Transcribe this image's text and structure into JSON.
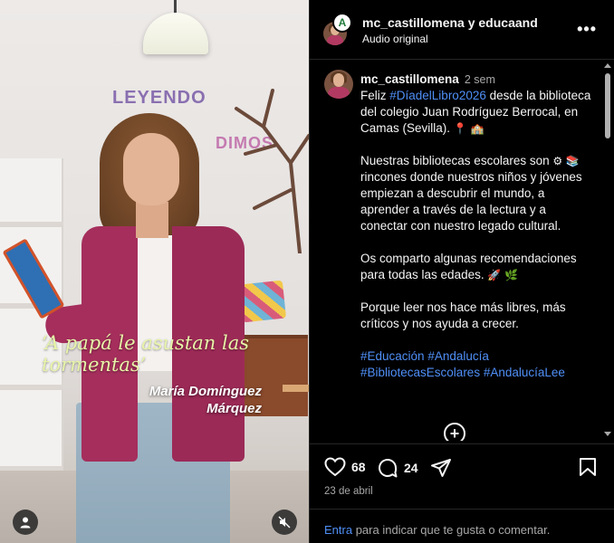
{
  "video": {
    "quote": "‘A papá le asustan las tormentas’",
    "author_first": "María Domínguez",
    "author_last": "Márquez",
    "wall_sign_1": "LEYENDO",
    "wall_sign_2": "DIMOS"
  },
  "header": {
    "title": "mc_castillomena y educaand",
    "subtitle": "Audio original",
    "logo_letter": "A",
    "more_label": "•••"
  },
  "caption": {
    "username": "mc_castillomena",
    "time": "2 sem",
    "p1_pre": "Feliz ",
    "p1_tag": "#DíadelLibro2026",
    "p1_post": " desde la biblioteca del colegio Juan Rodríguez Berrocal, en Camas (Sevilla).",
    "p2": "Nuestras bibliotecas escolares son",
    "p2b": " rincones donde nuestros niños y jóvenes empiezan a descubrir el mundo, a aprender a través de la lectura y a conectar con nuestro legado cultural.",
    "p3": "Os comparto algunas recomendaciones para todas las edades.",
    "p4": "Porque leer nos hace más libres, más críticos y nos ayuda a crecer.",
    "tag1": "#Educación",
    "tag2": "#Andalucía",
    "tag3": "#BibliotecasEscolares",
    "tag4": "#AndalucíaLee",
    "load_more": "+"
  },
  "actions": {
    "likes": "68",
    "comments": "24"
  },
  "date": "23 de abril",
  "footer": {
    "login_link": "Entra",
    "login_text": " para indicar que te gusta o comentar."
  },
  "colors": {
    "background": "#000000",
    "link": "#4f8ff7",
    "muted": "#a8a8a8",
    "quote": "#e7f4a8",
    "jacket": "#a52e5c"
  },
  "icons": [
    "user-icon",
    "mute-icon",
    "more-icon",
    "heart-icon",
    "comment-icon",
    "share-icon",
    "bookmark-icon",
    "plus-circle-icon"
  ]
}
